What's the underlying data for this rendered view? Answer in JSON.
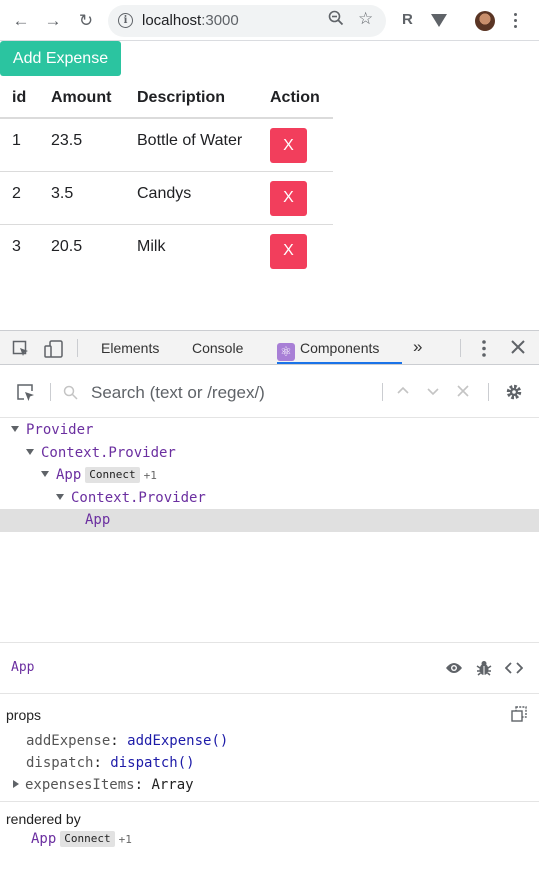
{
  "browser": {
    "url_host": "localhost",
    "url_port": ":3000",
    "extension_r": "R"
  },
  "page": {
    "add_button": "Add Expense",
    "table": {
      "headers": [
        "id",
        "Amount",
        "Description",
        "Action"
      ],
      "rows": [
        {
          "id": "1",
          "amount": "23.5",
          "description": "Bottle of Water",
          "action": "X"
        },
        {
          "id": "2",
          "amount": "3.5",
          "description": "Candys",
          "action": "X"
        },
        {
          "id": "3",
          "amount": "20.5",
          "description": "Milk",
          "action": "X"
        }
      ]
    }
  },
  "devtools": {
    "tabs": [
      "Elements",
      "Console",
      "Components"
    ],
    "active_tab": "Components",
    "more": "»",
    "search_placeholder": "Search (text or /regex/)",
    "tree": [
      {
        "name": "Provider"
      },
      {
        "name": "Context.Provider"
      },
      {
        "name": "App",
        "badge": "Connect",
        "extra": "+1"
      },
      {
        "name": "Context.Provider"
      },
      {
        "name": "App"
      }
    ],
    "inspector": {
      "title": "App",
      "props_label": "props",
      "props": [
        {
          "key": "addExpense",
          "value": "addExpense()"
        },
        {
          "key": "dispatch",
          "value": "dispatch()"
        },
        {
          "key": "expensesItems",
          "value": "Array"
        }
      ],
      "rendered_by_label": "rendered by",
      "rendered_by": {
        "name": "App",
        "badge": "Connect",
        "extra": "+1"
      }
    }
  },
  "colors": {
    "add_button": "#2bc4a0",
    "delete_button": "#f23e5c",
    "component_name": "#6b2fa0",
    "tab_underline": "#1a73e8"
  }
}
